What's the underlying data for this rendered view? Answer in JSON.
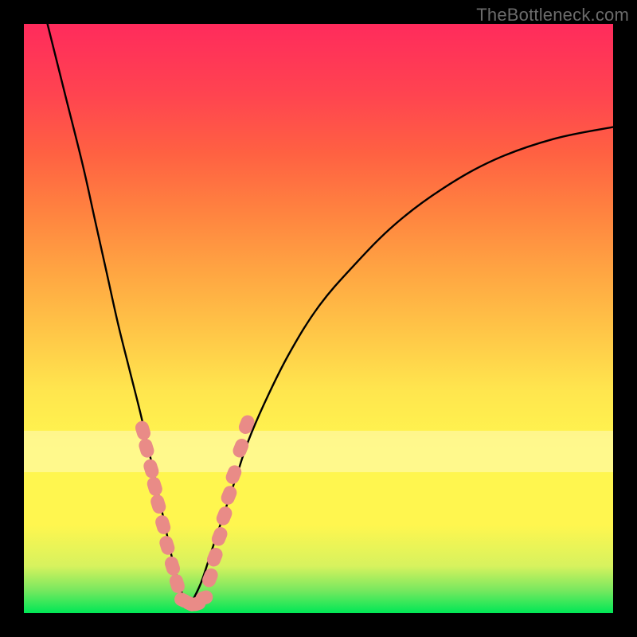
{
  "watermark": "TheBottleneck.com",
  "chart_data": {
    "type": "line",
    "title": "",
    "xlabel": "",
    "ylabel": "",
    "xlim": [
      0,
      100
    ],
    "ylim": [
      0,
      100
    ],
    "gradient_stops": [
      {
        "pos": 0,
        "color": "#00e756"
      },
      {
        "pos": 4,
        "color": "#7be85f"
      },
      {
        "pos": 8,
        "color": "#d7f25e"
      },
      {
        "pos": 15,
        "color": "#fff64f"
      },
      {
        "pos": 28,
        "color": "#fff64f"
      },
      {
        "pos": 38,
        "color": "#ffe54e"
      },
      {
        "pos": 48,
        "color": "#ffc547"
      },
      {
        "pos": 58,
        "color": "#ffa542"
      },
      {
        "pos": 68,
        "color": "#ff8340"
      },
      {
        "pos": 78,
        "color": "#ff6142"
      },
      {
        "pos": 88,
        "color": "#ff4450"
      },
      {
        "pos": 100,
        "color": "#ff2b5c"
      }
    ],
    "series": [
      {
        "name": "left_branch",
        "x": [
          4,
          7,
          10,
          12,
          14,
          16,
          18,
          20,
          22,
          23.5,
          25,
          26,
          27,
          28
        ],
        "y": [
          100,
          88,
          76,
          67,
          58,
          49,
          41,
          33,
          24,
          17,
          10,
          6,
          3,
          1
        ]
      },
      {
        "name": "right_branch",
        "x": [
          28,
          30,
          32,
          34,
          36,
          38,
          41,
          45,
          50,
          56,
          63,
          71,
          80,
          90,
          100
        ],
        "y": [
          1,
          5,
          11,
          17,
          23,
          29,
          36,
          44,
          52,
          59,
          66,
          72,
          77,
          80.5,
          82.5
        ]
      }
    ],
    "markers": {
      "comment": "pink rounded markers overlaid on lower portion of both branches",
      "color": "#e98b87",
      "left_cluster": [
        {
          "x": 20.2,
          "y": 31
        },
        {
          "x": 20.8,
          "y": 28
        },
        {
          "x": 21.6,
          "y": 24.5
        },
        {
          "x": 22.2,
          "y": 21.5
        },
        {
          "x": 22.8,
          "y": 18.5
        },
        {
          "x": 23.6,
          "y": 15
        },
        {
          "x": 24.3,
          "y": 11.5
        },
        {
          "x": 25.2,
          "y": 8
        },
        {
          "x": 26.0,
          "y": 5
        }
      ],
      "bottom_cluster": [
        {
          "x": 27.0,
          "y": 2.2
        },
        {
          "x": 28.2,
          "y": 1.6
        },
        {
          "x": 29.4,
          "y": 1.6
        },
        {
          "x": 30.6,
          "y": 2.6
        }
      ],
      "right_cluster": [
        {
          "x": 31.6,
          "y": 6
        },
        {
          "x": 32.4,
          "y": 9.5
        },
        {
          "x": 33.2,
          "y": 13
        },
        {
          "x": 34.0,
          "y": 16.5
        },
        {
          "x": 34.8,
          "y": 20
        },
        {
          "x": 35.6,
          "y": 23.5
        },
        {
          "x": 36.8,
          "y": 28
        },
        {
          "x": 37.8,
          "y": 32
        }
      ]
    },
    "pale_band": {
      "y_from": 24,
      "y_to": 31
    }
  }
}
